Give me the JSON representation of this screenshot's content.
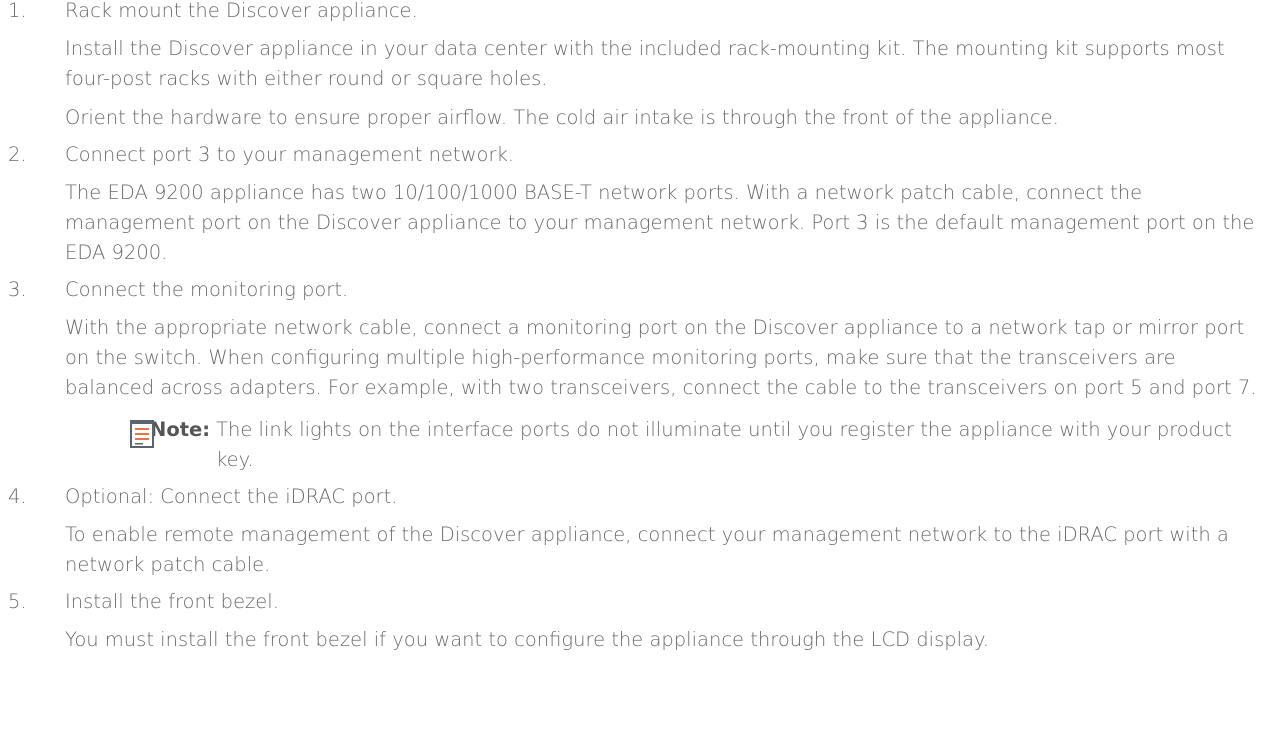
{
  "steps": [
    {
      "number": "1.",
      "title": "Rack mount the Discover appliance.",
      "paragraphs": [
        "Install the Discover appliance in your data center with the included rack-mounting kit. The mounting kit supports most four-post racks with either round or square holes.",
        "Orient the hardware to ensure proper airflow. The cold air intake is through the front of the appliance."
      ]
    },
    {
      "number": "2.",
      "title": "Connect port 3 to your management network.",
      "paragraphs": [
        "The EDA 9200 appliance has two 10/100/1000 BASE-T network ports. With a network patch cable, connect the management port on the Discover appliance to your management network. Port 3 is the default management port on the EDA 9200."
      ]
    },
    {
      "number": "3.",
      "title": "Connect the monitoring port.",
      "paragraphs": [
        "With the appropriate network cable, connect a monitoring port on the Discover appliance to a network tap or mirror port on the switch. When configuring multiple high-performance monitoring ports, make sure that the transceivers are balanced across adapters. For example, with two transceivers, connect the cable to the transceivers on port 5 and port 7."
      ],
      "note": {
        "icon": "note-icon",
        "label": "Note:",
        "text": "The link lights on the interface ports do not illuminate until you register the appliance with your product key."
      }
    },
    {
      "number": "4.",
      "title": "Optional: Connect the iDRAC port.",
      "paragraphs": [
        "To enable remote management of the Discover appliance, connect your management network to the iDRAC port with a network patch cable."
      ]
    },
    {
      "number": "5.",
      "title": "Install the front bezel.",
      "paragraphs": [
        "You must install the front bezel if you want to configure the appliance through the LCD display."
      ]
    }
  ],
  "colors": {
    "text": "#6a6a6a",
    "note_icon_lines": "#e8734a",
    "note_icon_frame": "#5a6470"
  }
}
